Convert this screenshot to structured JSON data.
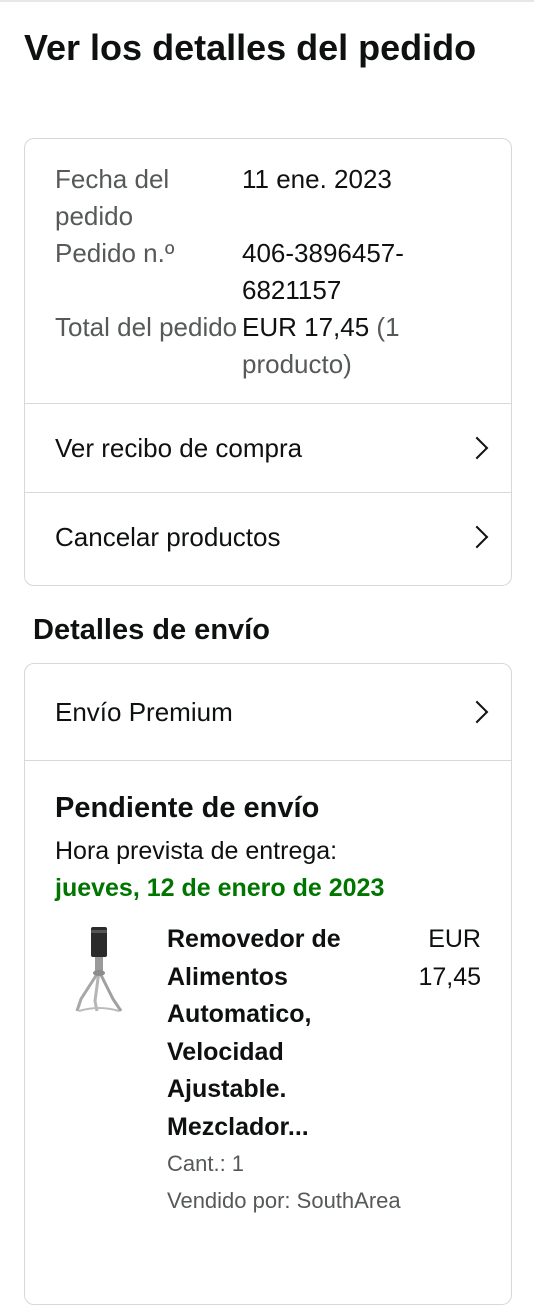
{
  "page": {
    "title": "Ver los detalles del pedido"
  },
  "summary": {
    "rows": [
      {
        "label": "Fecha del pedido",
        "value": "11 ene. 2023"
      },
      {
        "label": "Pedido n.º",
        "value": "406-3896457-6821157"
      },
      {
        "label": "Total del pedido",
        "value": "EUR 17,45",
        "extra": "(1 producto)"
      }
    ],
    "actions": [
      {
        "label": "Ver recibo de compra"
      },
      {
        "label": "Cancelar productos"
      }
    ]
  },
  "shipping": {
    "section_title": "Detalles de envío",
    "method": "Envío Premium",
    "status": "Pendiente de envío",
    "eta_label": "Hora prevista de entrega:",
    "eta_date": "jueves, 12 de enero de 2023",
    "item": {
      "title": "Removedor de Alimentos Automatico, Velocidad Ajustable. Mezclador...",
      "price": "EUR 17,45",
      "quantity": "Cant.: 1",
      "seller": "Vendido por: SouthArea",
      "image_icon": "stirrer-product-image"
    }
  },
  "colors": {
    "eta_green": "#007600",
    "border": "#d5d9d9",
    "muted_text": "#565959"
  }
}
